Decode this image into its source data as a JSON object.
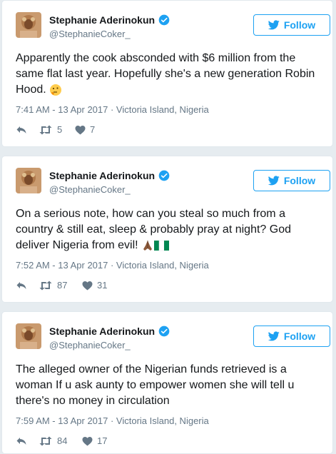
{
  "colors": {
    "accent": "#1da1f2",
    "text": "#14171a",
    "muted": "#657786",
    "background": "#e6ecf0"
  },
  "tweets": [
    {
      "name": "Stephanie Aderinokun",
      "handle": "@StephanieCoker_",
      "follow_label": "Follow",
      "text": "Apparently the cook absconded with $6 million from the same flat last year. Hopefully she's a new generation Robin Hood.",
      "emojis": [
        "thinking-face-emoji"
      ],
      "timestamp": "7:41 AM - 13 Apr 2017 · Victoria Island, Nigeria",
      "retweets": "5",
      "likes": "7"
    },
    {
      "name": "Stephanie Aderinokun",
      "handle": "@StephanieCoker_",
      "follow_label": "Follow",
      "text": "On a serious note, how can you steal so much from a country & still eat, sleep & probably pray at night? God deliver Nigeria from evil!",
      "emojis": [
        "praying-hands-emoji",
        "nigeria-flag-emoji"
      ],
      "timestamp": "7:52 AM - 13 Apr 2017 · Victoria Island, Nigeria",
      "retweets": "87",
      "likes": "31"
    },
    {
      "name": "Stephanie Aderinokun",
      "handle": "@StephanieCoker_",
      "follow_label": "Follow",
      "text": "The alleged owner of the Nigerian funds retrieved is a woman If u ask aunty to empower women she will tell u there's no money in circulation",
      "emojis": [],
      "timestamp": "7:59 AM - 13 Apr 2017 · Victoria Island, Nigeria",
      "retweets": "84",
      "likes": "17"
    }
  ]
}
